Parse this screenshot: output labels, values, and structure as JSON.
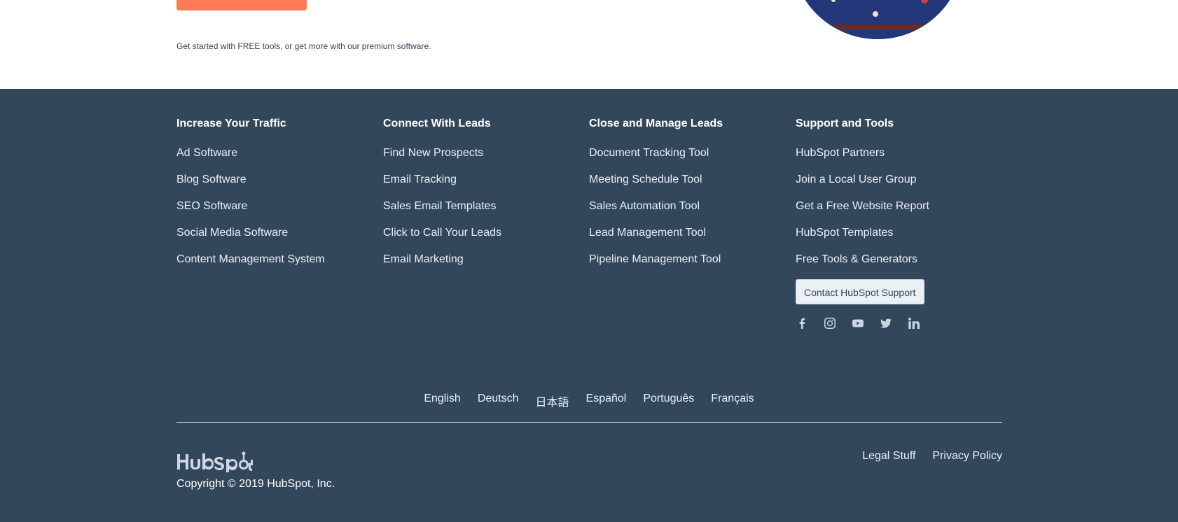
{
  "hero": {
    "tagline": "Get started with FREE tools, or get more with our premium software."
  },
  "footer": {
    "columns": [
      {
        "title": "Increase Your Traffic",
        "links": [
          "Ad Software",
          "Blog Software",
          "SEO Software",
          "Social Media Software",
          "Content Management System"
        ]
      },
      {
        "title": "Connect With Leads",
        "links": [
          "Find New Prospects",
          "Email Tracking",
          "Sales Email Templates",
          "Click to Call Your Leads",
          "Email Marketing"
        ]
      },
      {
        "title": "Close and Manage Leads",
        "links": [
          "Document Tracking Tool",
          "Meeting Schedule Tool",
          "Sales Automation Tool",
          "Lead Management Tool",
          "Pipeline Management Tool"
        ]
      },
      {
        "title": "Support and Tools",
        "links": [
          "HubSpot Partners",
          "Join a Local User Group",
          "Get a Free Website Report",
          "HubSpot Templates",
          "Free Tools & Generators"
        ]
      }
    ],
    "support_button": "Contact HubSpot Support",
    "social_icons": [
      "facebook-icon",
      "instagram-icon",
      "youtube-icon",
      "twitter-icon",
      "linkedin-icon"
    ],
    "languages": [
      "English",
      "Deutsch",
      "日本語",
      "Español",
      "Português",
      "Français"
    ],
    "copyright": "Copyright © 2019 HubSpot, Inc.",
    "legal_links": [
      "Legal Stuff",
      "Privacy Policy"
    ]
  },
  "colors": {
    "footer_bg": "#33475b",
    "cta": "#ff7a59",
    "text_light": "#eaf0f6"
  }
}
